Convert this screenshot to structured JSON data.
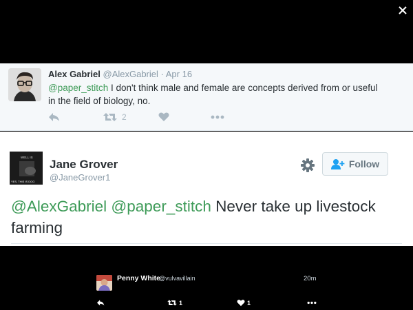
{
  "parent_tweet": {
    "name": "Alex Gabriel",
    "handle": "@AlexGabriel",
    "separator": " · ",
    "date": "Apr 16",
    "mention": "@paper_stitch",
    "text": " I don't think male and female are concepts derived from or useful in the field of biology, no.",
    "retweet_count": "2"
  },
  "main_tweet": {
    "name": "Jane Grover",
    "handle": "@JaneGrover1",
    "follow_label": "Follow",
    "mention_1": "@AlexGabriel",
    "mention_2": "@paper_stitch",
    "text": " Never take up livestock farming",
    "avatar_text_top": "WELL IS",
    "avatar_text_bottom": "YES, THIS IS DOG"
  },
  "bottom_tweet": {
    "name": "Penny White",
    "handle": "@vulvavillain",
    "time": "20m",
    "retweet_count": "1",
    "like_count": "1"
  },
  "colors": {
    "mention": "#3e9b58",
    "icon_gray": "#aab8c2",
    "parent_bg": "#f5f8fa"
  }
}
